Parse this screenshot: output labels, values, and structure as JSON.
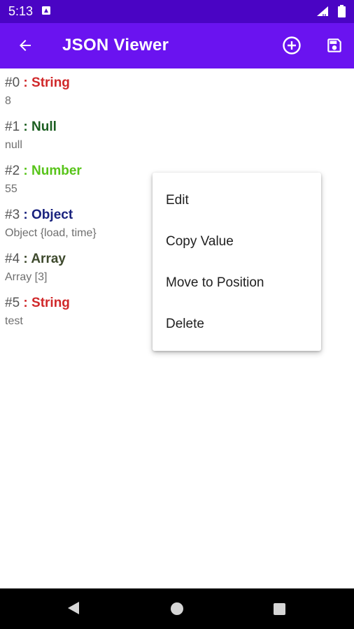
{
  "status_bar": {
    "time": "5:13"
  },
  "app_bar": {
    "title": "JSON Viewer"
  },
  "items": [
    {
      "index": "#0",
      "sep": " : ",
      "type": "String",
      "type_color": "#d0282a",
      "value": "8"
    },
    {
      "index": "#1",
      "sep": " : ",
      "type": "Null",
      "type_color": "#1b5e20",
      "value": "null"
    },
    {
      "index": "#2",
      "sep": " : ",
      "type": "Number",
      "type_color": "#58c41a",
      "value": "55"
    },
    {
      "index": "#3",
      "sep": " : ",
      "type": "Object",
      "type_color": "#1a237e",
      "value": "Object {load, time}"
    },
    {
      "index": "#4",
      "sep": " : ",
      "type": "Array",
      "type_color": "#3e4a2d",
      "value": "Array [3]"
    },
    {
      "index": "#5",
      "sep": " : ",
      "type": "String",
      "type_color": "#d0282a",
      "value": "test"
    }
  ],
  "context_menu": {
    "items": [
      "Edit",
      "Copy Value",
      "Move to Position",
      "Delete"
    ]
  },
  "colors": {
    "status_bar": "#4a04c4",
    "app_bar": "#6a13f0"
  },
  "icons": {
    "back": "arrow-left-icon",
    "add": "add-circle-icon",
    "save": "save-icon"
  }
}
